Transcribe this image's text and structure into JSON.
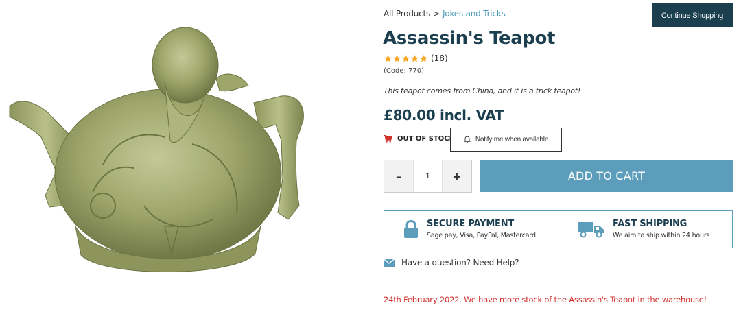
{
  "breadcrumb": {
    "home": "All Products",
    "separator": ">",
    "current": "Jokes and Tricks"
  },
  "header": {
    "continue_label": "Continue Shopping"
  },
  "product": {
    "title": "Assassin's Teapot",
    "rating": 5,
    "rating_max": 5,
    "review_count": "(18)",
    "code": "(Code: 770)",
    "description": "This teapot comes from China, and it is a trick teapot!",
    "price": "£80.00  incl. VAT",
    "stock_status": "OUT OF STOCK",
    "notify_label": "Notify me when available",
    "quantity": "1",
    "add_to_cart_label": "ADD TO CART"
  },
  "trust": {
    "secure_title": "SECURE PAYMENT",
    "secure_sub": "Sage pay, Visa, PayPal, Mastercard",
    "shipping_title": "FAST SHIPPING",
    "shipping_sub": "We aim to ship within 24 hours"
  },
  "help": {
    "label": "Have a question? Need Help?"
  },
  "notice": {
    "text": "24th February 2022. We have more stock of the Assassin's Teapot in the warehouse!"
  },
  "colors": {
    "navy": "#1c3f50",
    "accent": "#5b9dbb",
    "star": "#f5a623",
    "alert": "#d0312d",
    "teapot": "#9aa36a"
  },
  "icons": {
    "cart": "cart-icon",
    "bell": "bell-icon",
    "lock": "lock-icon",
    "truck": "truck-icon",
    "mail": "mail-icon",
    "star": "star-icon"
  }
}
